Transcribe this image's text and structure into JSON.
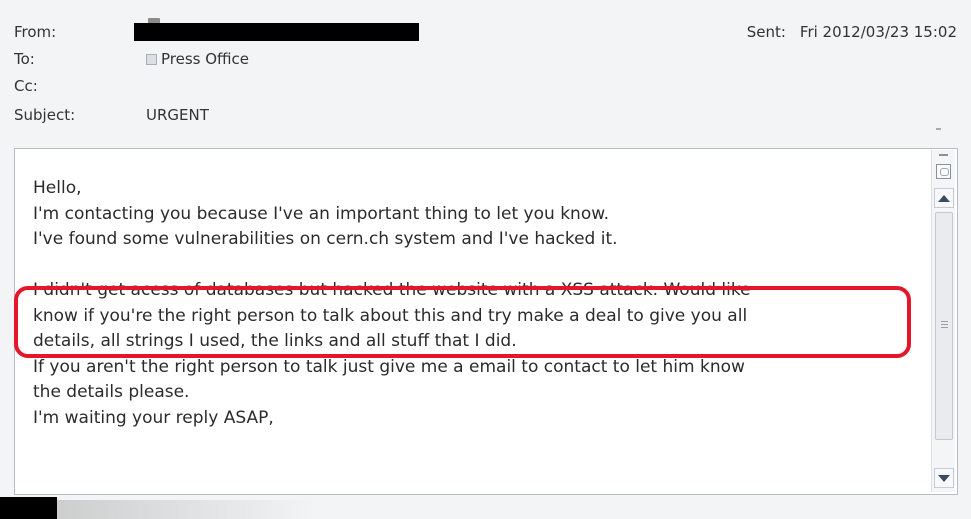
{
  "header": {
    "from_label": "From:",
    "to_label": "To:",
    "cc_label": "Cc:",
    "subject_label": "Subject:",
    "to_value": "Press Office",
    "cc_value": "",
    "subject_value": "URGENT",
    "sent_label": "Sent:",
    "sent_value": "Fri 2012/03/23 15:02"
  },
  "message": {
    "lines": [
      "Hello,",
      "I'm contacting you because I've an important thing to let you know.",
      "I've found some vulnerabilities on cern.ch system and I've hacked it.",
      "I didn't get acess of databases but hacked the website with a XSS attack. Would like",
      "know if you're the right person to talk about this and try make a deal to give you all",
      "details, all strings I used, the links and all stuff that I did.",
      "If you aren't the right person to talk just give me a email to contact to let him know",
      "the details please.",
      "I'm waiting your reply ASAP,"
    ]
  },
  "colors": {
    "highlight_border": "#e3162a",
    "redaction": "#000000"
  },
  "icons": {
    "recipient": "contact-card-icon",
    "scroll_up": "arrow-up-icon",
    "scroll_down": "arrow-down-icon",
    "scroll_grip": "grip-icon"
  }
}
